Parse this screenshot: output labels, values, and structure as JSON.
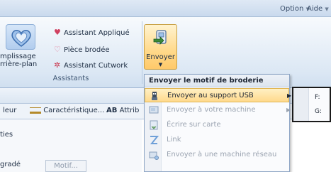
{
  "menu": {
    "option_label": "Option",
    "aide_label": "Aide"
  },
  "ribbon": {
    "left_label_line1": "mplissage",
    "left_label_line2": "rrière-plan",
    "items": [
      {
        "icon": "heart-applique-icon",
        "label": "Assistant Appliqué"
      },
      {
        "icon": "heart-embroidered-icon",
        "label": "Pièce brodée"
      },
      {
        "icon": "cutwork-icon",
        "label": "Assistant Cutwork"
      }
    ],
    "group_label": "Assistants",
    "send_button_label": "Envoyer"
  },
  "dropdown": {
    "header": "Envoyer le motif de broderie",
    "items": [
      {
        "label": "Envoyer au support USB",
        "icon": "usb-icon",
        "enabled": true,
        "has_submenu": true
      },
      {
        "label": "Envoyer à votre machine",
        "icon": "machine-icon",
        "enabled": false,
        "has_submenu": true
      },
      {
        "label": "Écrire sur carte",
        "icon": "card-icon",
        "enabled": false,
        "has_submenu": false
      },
      {
        "label": "Link",
        "icon": "link-icon",
        "enabled": false,
        "has_submenu": false
      },
      {
        "label": "Envoyer à une machine réseau",
        "icon": "network-machine-icon",
        "enabled": false,
        "has_submenu": false
      }
    ]
  },
  "submenu": {
    "drives": [
      "F:",
      "G:"
    ]
  },
  "tabs": {
    "tab1": "leur",
    "tab2": "Caractéristique...",
    "tab3_prefix": "AB",
    "tab3": "Attrib"
  },
  "panel": {
    "line1": "ties",
    "line2": "gradé",
    "motif_button": "Motif..."
  }
}
